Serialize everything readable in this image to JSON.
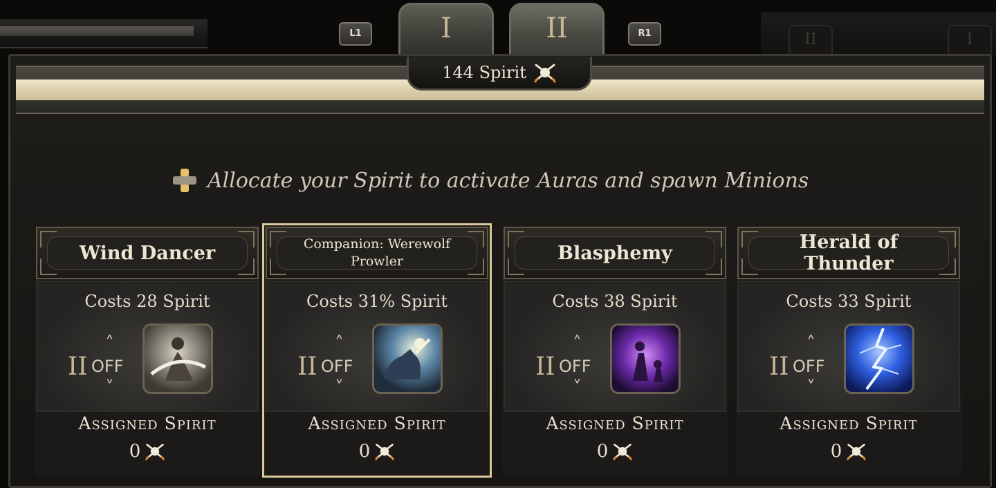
{
  "tabs": {
    "left_shoulder": "L1",
    "right_shoulder": "R1",
    "items": [
      {
        "label": "I",
        "active": false
      },
      {
        "label": "II",
        "active": true
      }
    ]
  },
  "spirit": {
    "total": "144 Spirit",
    "icon": "spirit-icon"
  },
  "instruction": {
    "text": "Allocate your Spirit to activate Auras and spawn Minions",
    "icon": "dpad-icon"
  },
  "skills": [
    {
      "name": "Wind Dancer",
      "cost": "Costs 28 Spirit",
      "rank": "II",
      "state": "OFF",
      "assigned_label": "Assigned Spirit",
      "assigned_value": "0",
      "selected": false,
      "icon": "wind-dancer-icon"
    },
    {
      "name": "Companion: Werewolf Prowler",
      "cost": "Costs 31% Spirit",
      "rank": "II",
      "state": "OFF",
      "assigned_label": "Assigned Spirit",
      "assigned_value": "0",
      "selected": true,
      "icon": "werewolf-prowler-icon"
    },
    {
      "name": "Blasphemy",
      "cost": "Costs 38 Spirit",
      "rank": "II",
      "state": "OFF",
      "assigned_label": "Assigned Spirit",
      "assigned_value": "0",
      "selected": false,
      "icon": "blasphemy-icon"
    },
    {
      "name": "Herald of Thunder",
      "cost": "Costs 33 Spirit",
      "rank": "II",
      "state": "OFF",
      "assigned_label": "Assigned Spirit",
      "assigned_value": "0",
      "selected": false,
      "icon": "herald-of-thunder-icon"
    }
  ],
  "colors": {
    "accent_gold": "#d9c99a",
    "spirit_orange": "#e08a2a"
  }
}
